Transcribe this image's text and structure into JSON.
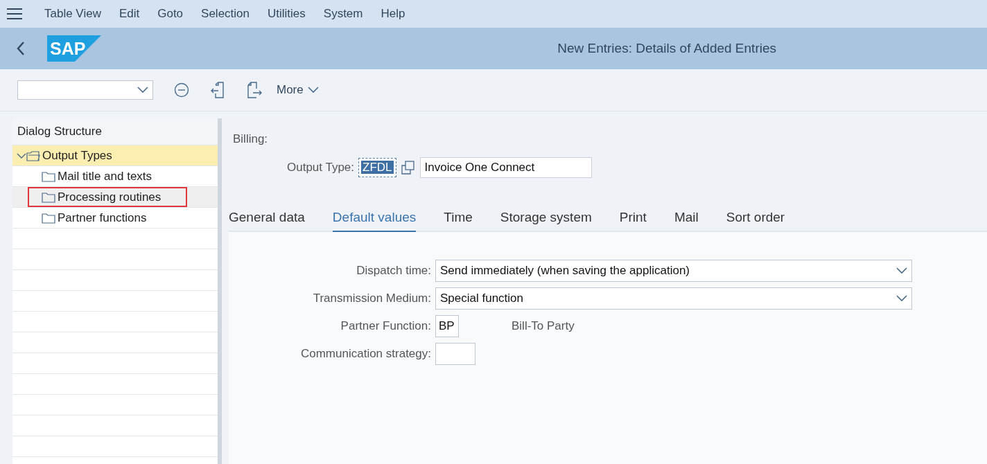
{
  "menu": [
    "Table View",
    "Edit",
    "Goto",
    "Selection",
    "Utilities",
    "System",
    "Help"
  ],
  "header": {
    "logo": "SAP",
    "title": "New Entries: Details of Added Entries"
  },
  "toolbar": {
    "more": "More"
  },
  "dialog_structure": {
    "title": "Dialog Structure",
    "nodes": [
      {
        "label": "Output Types",
        "expanded": true,
        "selected": true,
        "annotated": false,
        "children": [
          {
            "label": "Mail title and texts",
            "selected": false,
            "annotated": false
          },
          {
            "label": "Processing routines",
            "selected": false,
            "annotated": true
          },
          {
            "label": "Partner functions",
            "selected": false,
            "annotated": false
          }
        ]
      }
    ]
  },
  "section_label": "Billing:",
  "output_type": {
    "label": "Output Type:",
    "code": "ZFDL",
    "description": "Invoice One Connect"
  },
  "tabs": [
    {
      "label": "General data",
      "selected": false
    },
    {
      "label": "Default values",
      "selected": true
    },
    {
      "label": "Time",
      "selected": false
    },
    {
      "label": "Storage system",
      "selected": false
    },
    {
      "label": "Print",
      "selected": false
    },
    {
      "label": "Mail",
      "selected": false
    },
    {
      "label": "Sort order",
      "selected": false
    }
  ],
  "fields": [
    {
      "kind": "dropdown",
      "label": "Dispatch time:",
      "value": "Send immediately (when saving the application)"
    },
    {
      "kind": "dropdown",
      "label": "Transmission Medium:",
      "value": "Special function"
    },
    {
      "kind": "short",
      "label": "Partner Function:",
      "value": "BP",
      "description": "Bill-To Party"
    },
    {
      "kind": "short",
      "label": "Communication strategy:"
    }
  ]
}
